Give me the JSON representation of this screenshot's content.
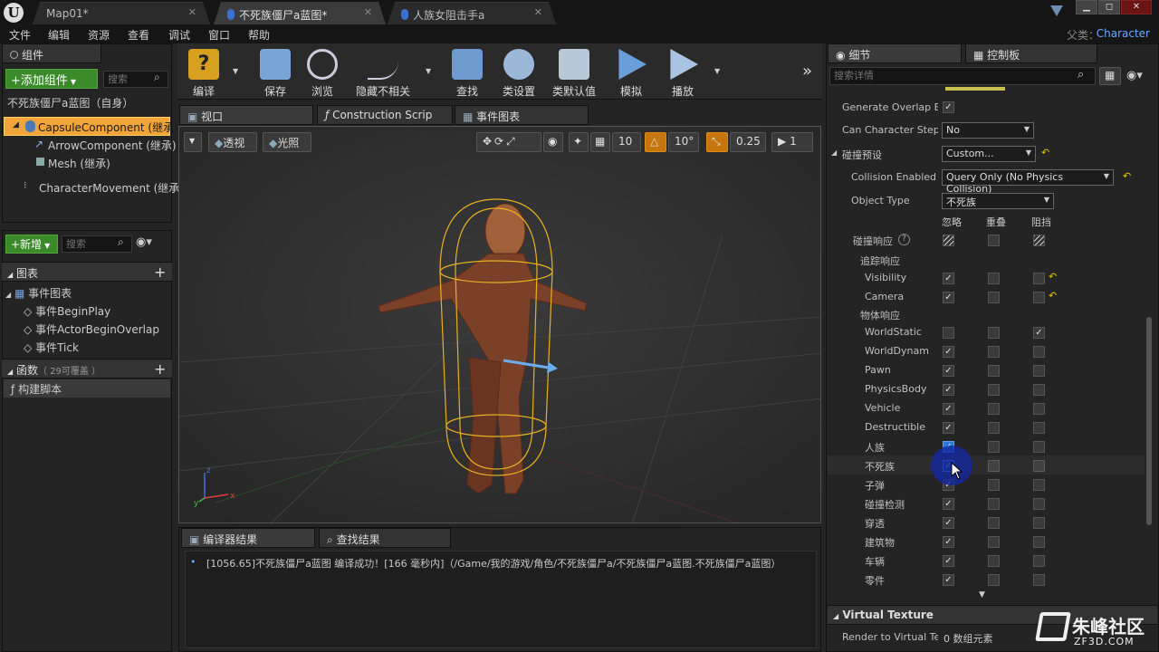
{
  "titlebar": {
    "tabs": [
      {
        "label": "Map01*"
      },
      {
        "label": "不死族僵尸a蓝图*"
      },
      {
        "label": "人族女阻击手a"
      }
    ],
    "close_glyph": "✕",
    "window_buttons": {
      "minimize": "▁",
      "maximize": "◻",
      "close": "✕"
    }
  },
  "menubar": {
    "items": [
      "文件",
      "编辑",
      "资源",
      "查看",
      "调试",
      "窗口",
      "帮助"
    ],
    "parent_label": "父类：",
    "parent_value": "Character"
  },
  "components": {
    "tab_label": "组件",
    "add_button": "+添加组件",
    "search_placeholder": "搜索",
    "self_item": "不死族僵尸a蓝图（自身）",
    "items": [
      {
        "label": "CapsuleComponent (继承)"
      },
      {
        "label": "ArrowComponent (继承)"
      },
      {
        "label": "Mesh (继承)"
      },
      {
        "label": "CharacterMovement (继承)"
      }
    ]
  },
  "mybp": {
    "new_button": "+新增",
    "search_placeholder": "搜索",
    "graphs_header": "图表",
    "event_graph": "事件图表",
    "events": [
      "事件BeginPlay",
      "事件ActorBeginOverlap",
      "事件Tick"
    ],
    "functions_header": "函数",
    "functions_override": "（ 29可覆盖 ）",
    "construction": "构建脚本"
  },
  "toolbar": {
    "buttons": [
      "编译",
      "保存",
      "浏览",
      "隐藏不相关",
      "查找",
      "类设置",
      "类默认值",
      "模拟",
      "播放"
    ]
  },
  "editor_tabs": [
    "视口",
    "Construction Scrip",
    "事件图表"
  ],
  "viewport": {
    "perspective": "透视",
    "lit": "光照",
    "grid_snap": "10",
    "rot_snap": "10°",
    "scale_snap": "0.25",
    "camera_speed": "1"
  },
  "output": {
    "tabs": [
      "编译器结果",
      "查找结果"
    ],
    "message": "[1056.65]不死族僵尸a蓝图 编译成功！[166 毫秒内]（/Game/我的游戏/角色/不死族僵尸a/不死族僵尸a蓝图.不死族僵尸a蓝图）"
  },
  "details": {
    "tabs": [
      "细节",
      "控制板"
    ],
    "search_placeholder": "搜索详情",
    "rows": {
      "generate_overlap": "Generate Overlap Eve",
      "can_step_up": "Can Character Step U",
      "can_step_up_value": "No",
      "collision_presets": "碰撞预设",
      "collision_presets_value": "Custom...",
      "collision_enabled": "Collision Enabled",
      "collision_enabled_value": "Query Only (No Physics Collision)",
      "object_type": "Object Type",
      "object_type_value": "不死族",
      "col_ignore": "忽略",
      "col_overlap": "重叠",
      "col_block": "阻挡",
      "collision_responses": "碰撞响应",
      "trace_responses": "追踪响应",
      "object_responses": "物体响应"
    },
    "channels": [
      {
        "name": "Visibility",
        "ignore": true,
        "overlap": false,
        "block": false,
        "reset": true
      },
      {
        "name": "Camera",
        "ignore": true,
        "overlap": false,
        "block": false,
        "reset": true
      },
      {
        "name": "WorldStatic",
        "ignore": false,
        "overlap": false,
        "block": true
      },
      {
        "name": "WorldDynam",
        "ignore": true,
        "overlap": false,
        "block": false
      },
      {
        "name": "Pawn",
        "ignore": true,
        "overlap": false,
        "block": false
      },
      {
        "name": "PhysicsBody",
        "ignore": true,
        "overlap": false,
        "block": false
      },
      {
        "name": "Vehicle",
        "ignore": true,
        "overlap": false,
        "block": false
      },
      {
        "name": "Destructible",
        "ignore": true,
        "overlap": false,
        "block": false
      },
      {
        "name": "人族",
        "ignore": true,
        "overlap": false,
        "block": false
      },
      {
        "name": "不死族",
        "ignore": true,
        "overlap": false,
        "block": false
      },
      {
        "name": "子弹",
        "ignore": true,
        "overlap": false,
        "block": false
      },
      {
        "name": "碰撞检测",
        "ignore": true,
        "overlap": false,
        "block": false
      },
      {
        "name": "穿透",
        "ignore": true,
        "overlap": false,
        "block": false
      },
      {
        "name": "建筑物",
        "ignore": true,
        "overlap": false,
        "block": false
      },
      {
        "name": "车辆",
        "ignore": true,
        "overlap": false,
        "block": false
      },
      {
        "name": "零件",
        "ignore": true,
        "overlap": false,
        "block": false
      }
    ],
    "virtual_texture_header": "Virtual Texture",
    "render_to_vt": "Render to Virtual Tex",
    "render_to_vt_value": "0 数组元素"
  },
  "watermark": {
    "logo_text": "朱峰社区",
    "url": "ZF3D.COM"
  }
}
